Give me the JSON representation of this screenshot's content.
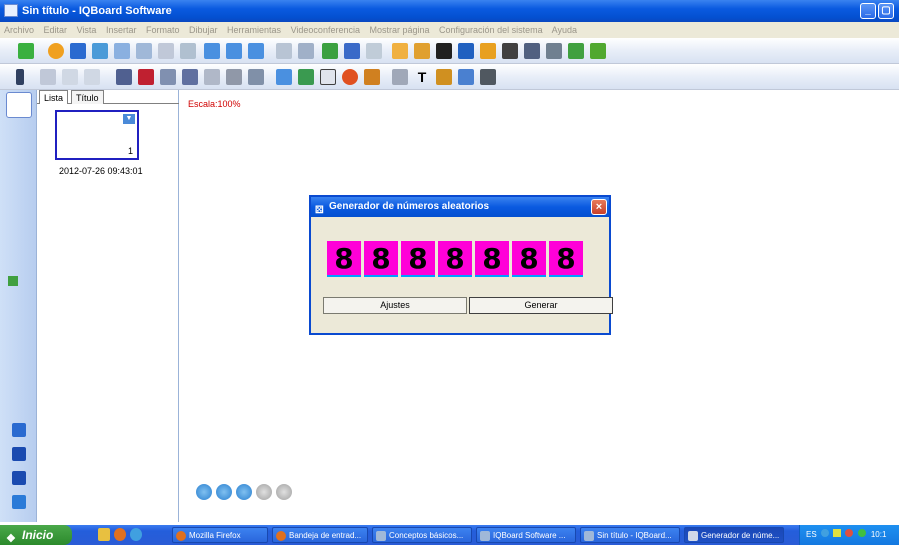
{
  "window": {
    "title": "Sin título - IQBoard Software"
  },
  "menu": {
    "items": [
      "Archivo",
      "Editar",
      "Vista",
      "Insertar",
      "Formato",
      "Dibujar",
      "Herramientas",
      "Videoconferencia",
      "Mostrar página",
      "Configuración del sistema",
      "Ayuda"
    ]
  },
  "panel": {
    "tabs": [
      "Lista",
      "Título"
    ],
    "thumbnail_number": "1",
    "thumbnail_date": "2012-07-26 09:43:01"
  },
  "canvas": {
    "scale_label": "Escala:100%"
  },
  "dialog": {
    "title": "Generador de números aleatorios",
    "digits": [
      "8",
      "8",
      "8",
      "8",
      "8",
      "8",
      "8"
    ],
    "settings_label": "Ajustes",
    "generate_label": "Generar",
    "digit_color": "#ff00d8"
  },
  "taskbar": {
    "start_label": "Inicio",
    "items": [
      "Mozilla Firefox",
      "Bandeja de entrad...",
      "Conceptos básicos...",
      "IQBoard Software ...",
      "Sin título - IQBoard...",
      "Generador de núme..."
    ],
    "tray_text": "ES",
    "clock": "10:1"
  }
}
